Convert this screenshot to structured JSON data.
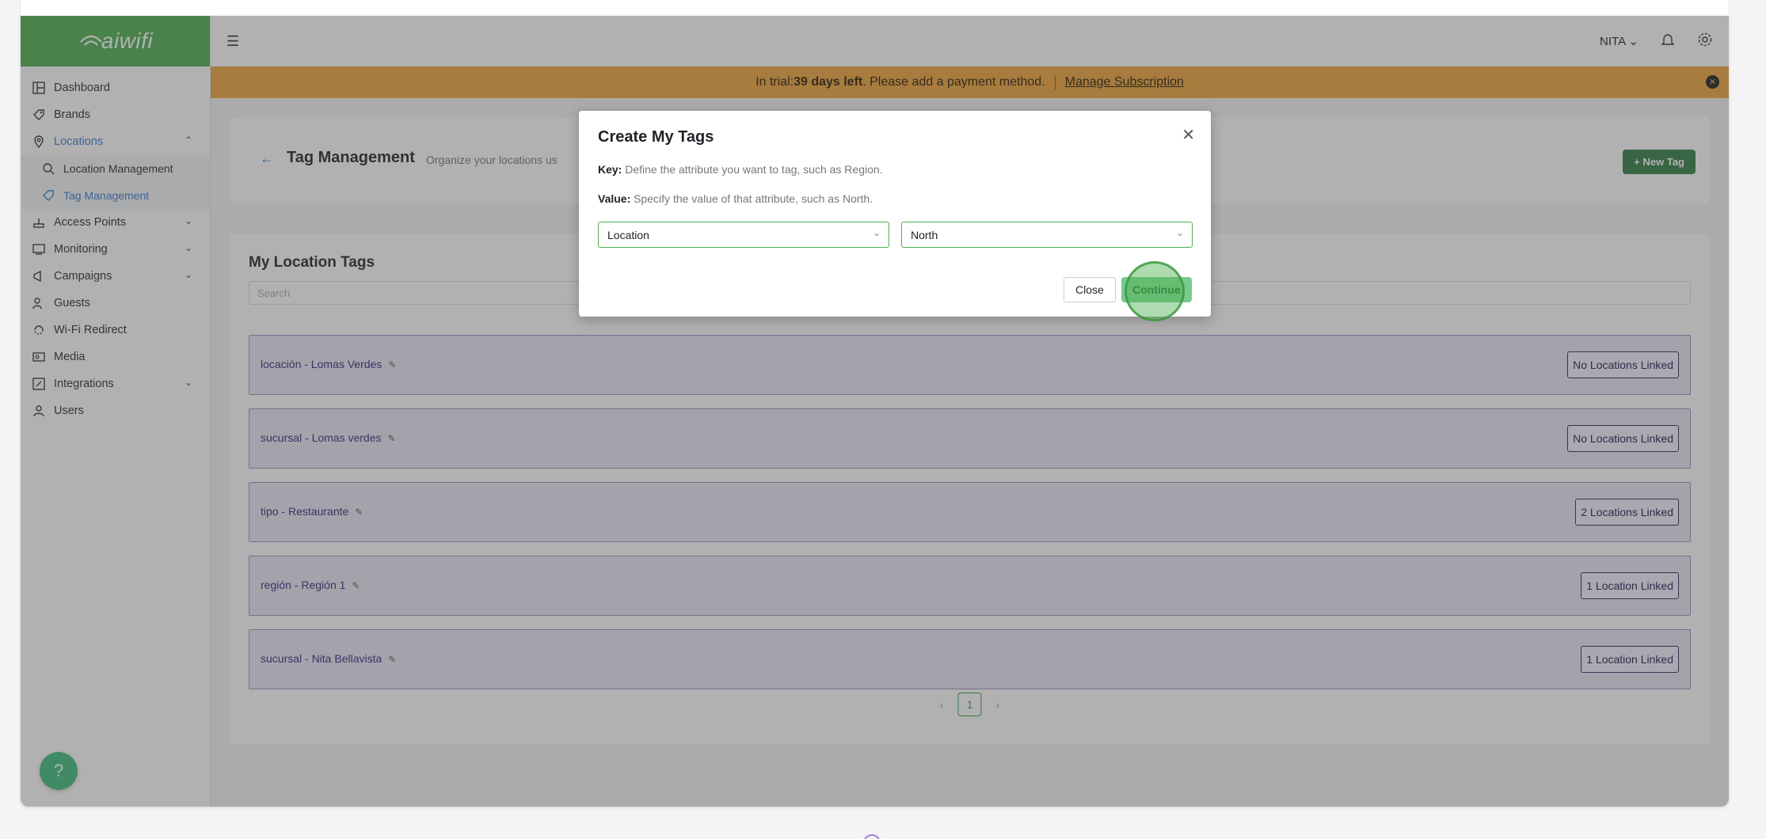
{
  "app": {
    "logo_text": "aiwifi",
    "brand_color": "#4caf50"
  },
  "sidebar": {
    "items": [
      {
        "label": "Dashboard",
        "icon": "dashboard-icon"
      },
      {
        "label": "Brands",
        "icon": "brand-icon"
      },
      {
        "label": "Locations",
        "icon": "location-pin-icon",
        "expanded": true
      },
      {
        "label": "Access Points",
        "icon": "access-point-icon"
      },
      {
        "label": "Monitoring",
        "icon": "monitor-icon"
      },
      {
        "label": "Campaigns",
        "icon": "megaphone-icon"
      },
      {
        "label": "Guests",
        "icon": "guests-icon"
      },
      {
        "label": "Wi-Fi Redirect",
        "icon": "redirect-icon"
      },
      {
        "label": "Media",
        "icon": "media-icon"
      },
      {
        "label": "Integrations",
        "icon": "integrations-icon"
      },
      {
        "label": "Users",
        "icon": "user-icon"
      }
    ],
    "sub_items": [
      {
        "label": "Location Management",
        "icon": "location-search-icon"
      },
      {
        "label": "Tag Management",
        "icon": "tag-icon"
      }
    ]
  },
  "header": {
    "user": "NITA"
  },
  "banner": {
    "prefix": "In trial: ",
    "days": "39 days left",
    "suffix": ". Please add a payment method.",
    "manage_label": "Manage Subscription"
  },
  "page": {
    "title": "Tag Management",
    "subtitle": "Organize your locations us",
    "new_tag_label": "+ New Tag",
    "list_title": "My Location Tags",
    "search_placeholder": "Search",
    "tags": [
      {
        "label": "locación - Lomas Verdes",
        "linked": "No Locations Linked"
      },
      {
        "label": "sucursal - Lomas verdes",
        "linked": "No Locations Linked"
      },
      {
        "label": "tipo - Restaurante",
        "linked": "2 Locations Linked"
      },
      {
        "label": "región - Región 1",
        "linked": "1 Location Linked"
      },
      {
        "label": "sucursal - Nita Bellavista",
        "linked": "1 Location Linked"
      }
    ],
    "pagination": {
      "current": "1"
    }
  },
  "help_label": "?",
  "modal": {
    "title": "Create My Tags",
    "key_label": "Key:",
    "key_text": " Define the attribute you want to tag, such as Region.",
    "value_label": "Value:",
    "value_text": " Specify the value of that attribute, such as North.",
    "key_select": "Location",
    "value_select": "North",
    "close_label": "Close",
    "continue_label": "Continue"
  }
}
